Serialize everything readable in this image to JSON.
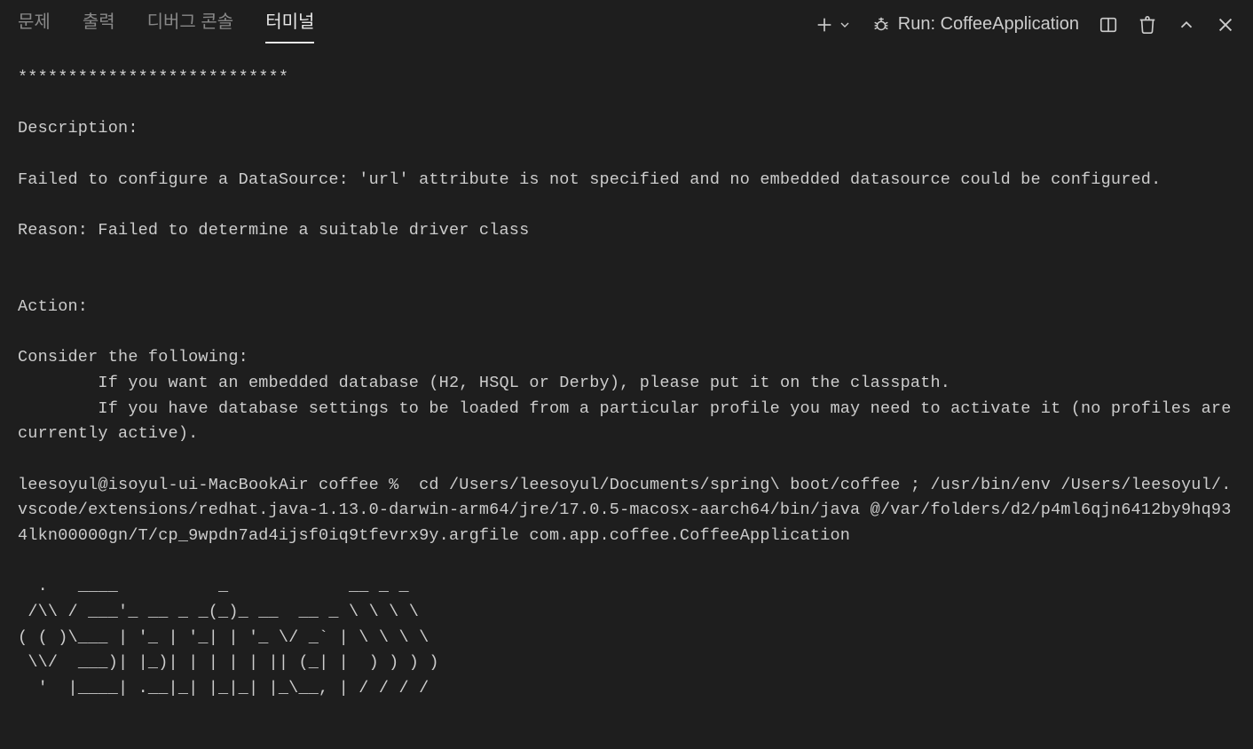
{
  "tabs": {
    "problems": "문제",
    "output": "출력",
    "debug_console": "디버그 콘솔",
    "terminal": "터미널"
  },
  "toolbar": {
    "run_label": "Run: CoffeeApplication"
  },
  "terminal": {
    "text": "***************************\n\nDescription:\n\nFailed to configure a DataSource: 'url' attribute is not specified and no embedded datasource could be configured.\n\nReason: Failed to determine a suitable driver class\n\n\nAction:\n\nConsider the following:\n        If you want an embedded database (H2, HSQL or Derby), please put it on the classpath.\n        If you have database settings to be loaded from a particular profile you may need to activate it (no profiles are currently active).\n\nleesoyul@isoyul-ui-MacBookAir coffee %  cd /Users/leesoyul/Documents/spring\\ boot/coffee ; /usr/bin/env /Users/leesoyul/.vscode/extensions/redhat.java-1.13.0-darwin-arm64/jre/17.0.5-macosx-aarch64/bin/java @/var/folders/d2/p4ml6qjn6412by9hq934lkn00000gn/T/cp_9wpdn7ad4ijsf0iq9tfevrx9y.argfile com.app.coffee.CoffeeApplication \n\n  .   ____          _            __ _ _\n /\\\\ / ___'_ __ _ _(_)_ __  __ _ \\ \\ \\ \\\n( ( )\\___ | '_ | '_| | '_ \\/ _` | \\ \\ \\ \\\n \\\\/  ___)| |_)| | | | | || (_| |  ) ) ) )\n  '  |____| .__|_| |_|_| |_\\__, | / / / /"
  }
}
